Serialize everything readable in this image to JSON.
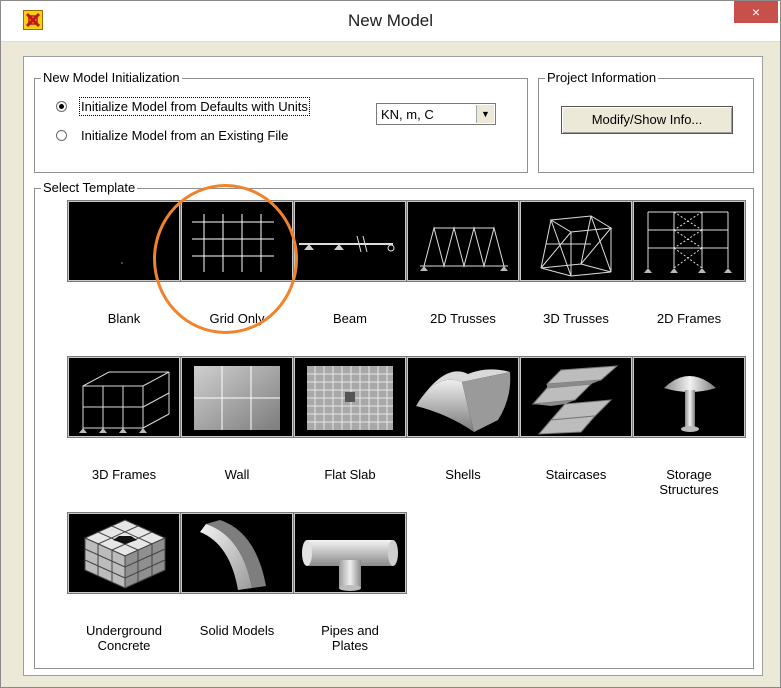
{
  "window": {
    "title": "New Model",
    "close_label": "×"
  },
  "init_group": {
    "legend": "New Model Initialization",
    "option_defaults": "Initialize Model from Defaults with Units",
    "option_existing": "Initialize Model  from an Existing File",
    "selected_option": "defaults",
    "units_value": "KN, m, C"
  },
  "project_group": {
    "legend": "Project Information",
    "button_label": "Modify/Show Info..."
  },
  "template_group": {
    "legend": "Select Template"
  },
  "templates": {
    "blank": "Blank",
    "grid_only": "Grid Only",
    "beam": "Beam",
    "trusses_2d": "2D Trusses",
    "trusses_3d": "3D Trusses",
    "frames_2d": "2D Frames",
    "frames_3d": "3D Frames",
    "wall": "Wall",
    "flat_slab": "Flat Slab",
    "shells": "Shells",
    "staircases": "Staircases",
    "storage_1": "Storage",
    "storage_2": "Structures",
    "underground_1": "Underground",
    "underground_2": "Concrete",
    "solid_models": "Solid Models",
    "pipes_1": "Pipes and",
    "pipes_2": "Plates"
  },
  "highlight": {
    "target": "grid-only",
    "color": "#f0832b"
  },
  "icons": {
    "app": "app-icon",
    "close": "close-icon",
    "dropdown": "chevron-down-icon"
  }
}
